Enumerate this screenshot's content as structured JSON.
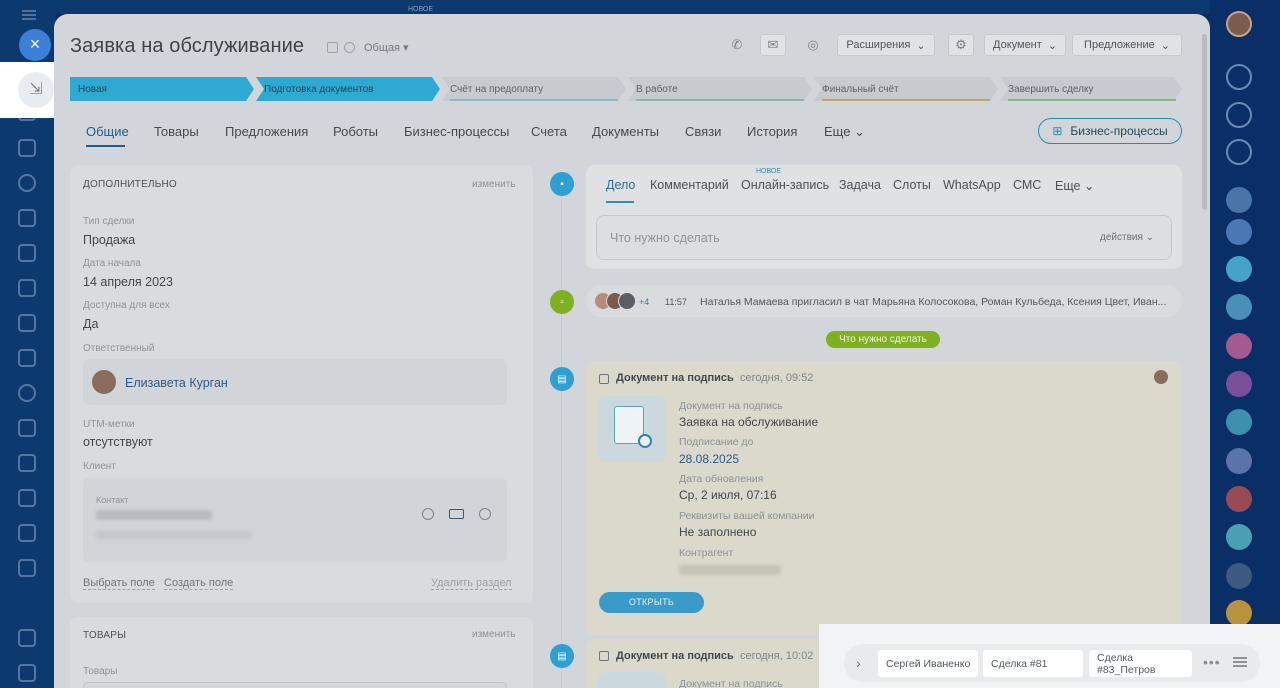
{
  "top_strip": {
    "new_badge": "НОВОЕ"
  },
  "header": {
    "title": "Заявка на обслуживание",
    "category": "Общая ▾",
    "buttons": {
      "extensions": "Расширения",
      "document": "Документ",
      "proposal": "Предложение"
    }
  },
  "stages": [
    {
      "label": "Новая"
    },
    {
      "label": "Подготовка документов"
    },
    {
      "label": "Счёт на предоплату"
    },
    {
      "label": "В работе"
    },
    {
      "label": "Финальный счёт"
    },
    {
      "label": "Завершить сделку"
    }
  ],
  "tabs": [
    "Общие",
    "Товары",
    "Предложения",
    "Роботы",
    "Бизнес-процессы",
    "Счета",
    "Документы",
    "Связи",
    "История",
    "Еще"
  ],
  "bp_button": "Бизнес-процессы",
  "left_card": {
    "heading": "ДОПОЛНИТЕЛЬНО",
    "edit": "изменить",
    "fields": [
      {
        "label": "Тип сделки",
        "value": "Продажа"
      },
      {
        "label": "Дата начала",
        "value": "14 апреля 2023"
      },
      {
        "label": "Доступна для всех",
        "value": "Да"
      }
    ],
    "responsible_label": "Ответственный",
    "responsible_name": "Елизавета Курган",
    "utm_label": "UTM-метки",
    "utm_value": "отсутствуют",
    "client_label": "Клиент",
    "contact_label": "Контакт",
    "select_field": "Выбрать поле",
    "create_field": "Создать поле",
    "delete_section": "Удалить раздел"
  },
  "products_card": {
    "heading": "ТОВАРЫ",
    "edit": "изменить",
    "label": "Товары"
  },
  "activity": {
    "tabs": [
      "Дело",
      "Комментарий",
      "Онлайн-запись",
      "Задача",
      "Слоты",
      "WhatsApp",
      "СМС",
      "Еще"
    ],
    "new_badge": "НОВОЕ",
    "placeholder": "Что нужно сделать",
    "actions": "действия"
  },
  "chat": {
    "count": "+4",
    "time": "11:57",
    "text": "Наталья Мамаева пригласил в чат Марьяна Колосокова, Роман Кульбеда, Ксения Цвет, Иван..."
  },
  "todo_badge": "Что нужно сделать",
  "doc1": {
    "title": "Документ на подпись",
    "time": "сегодня, 09:52",
    "doc_label": "Документ на подпись",
    "doc_value": "Заявка на обслуживание",
    "sign_label": "Подписание до",
    "sign_value": "28.08.2025",
    "updated_label": "Дата обновления",
    "updated_value": "Ср, 2 июля, 07:16",
    "req_label": "Реквизиты вашей компании",
    "req_value": "Не заполнено",
    "counterparty_label": "Контрагент",
    "open_button": "ОТКРЫТЬ"
  },
  "doc2": {
    "title": "Документ на подпись",
    "time": "сегодня, 10:02",
    "doc_label": "Документ на подпись"
  },
  "taskbar": {
    "items": [
      "Сергей Иваненко",
      "Сделка #81",
      "Сделка #83_Петров"
    ]
  },
  "colors": {
    "stage_active": "#2ea9d1",
    "accent_blue": "#3b7fd6",
    "todo_green": "#7fb021"
  }
}
